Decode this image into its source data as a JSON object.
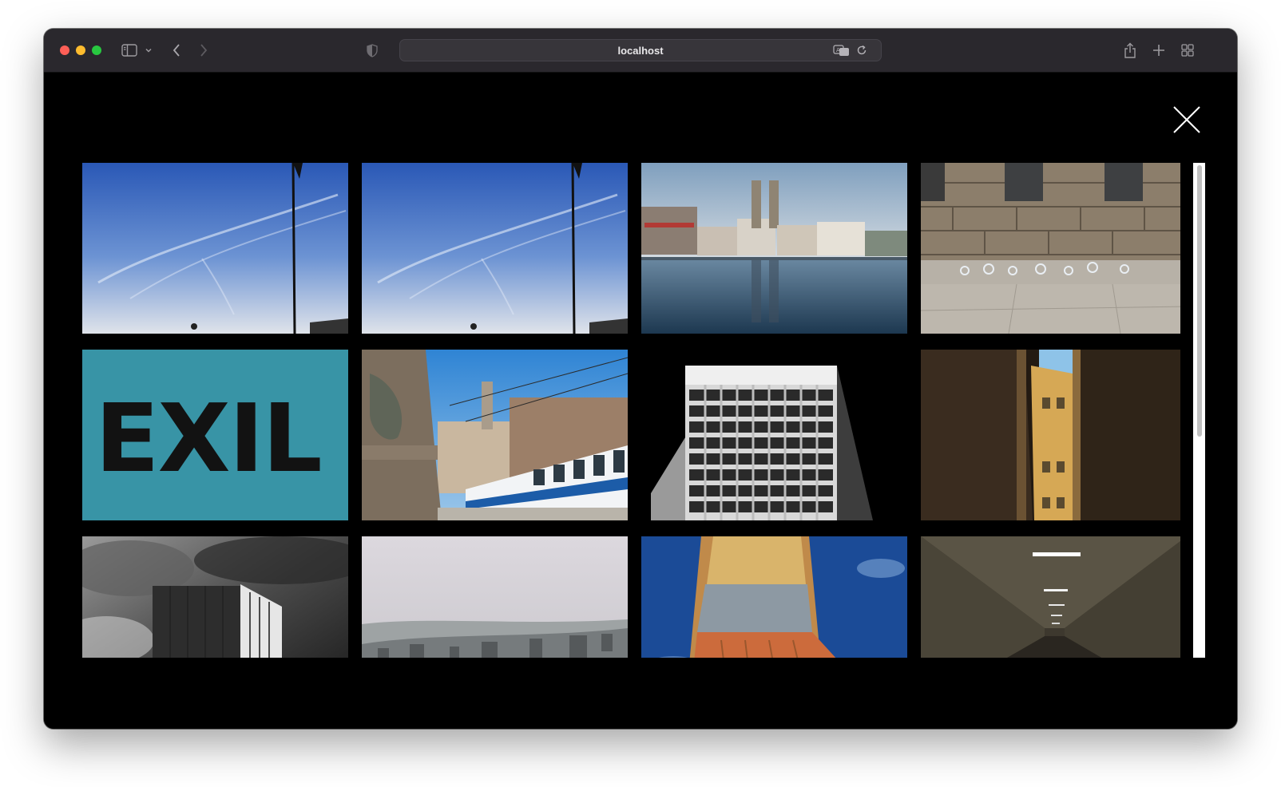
{
  "browser": {
    "url": "localhost",
    "icons": {
      "sidebar": "sidebar-icon",
      "back": "chevron-left-icon",
      "forward": "chevron-right-icon",
      "shield": "shield-icon",
      "translate": "translate-icon",
      "reload": "reload-icon",
      "share": "share-icon",
      "new_tab": "plus-icon",
      "tab_overview": "grid-icon"
    }
  },
  "overlay": {
    "close_icon": "close-icon"
  },
  "gallery": {
    "columns": 4,
    "visible_rows": 3,
    "photos": [
      {
        "id": 1,
        "subject": "sky-with-flagpole",
        "colors": [
          "#2f5fb8",
          "#c9d7ea"
        ]
      },
      {
        "id": 2,
        "subject": "sky-with-flagpole",
        "colors": [
          "#2f5fb8",
          "#c9d7ea"
        ]
      },
      {
        "id": 3,
        "subject": "river-city-churches",
        "colors": [
          "#a9c0d6",
          "#27435a"
        ]
      },
      {
        "id": 4,
        "subject": "stone-wall-graffiti",
        "colors": [
          "#9a8c78",
          "#b9b2a6"
        ]
      },
      {
        "id": 5,
        "subject": "exil-sign",
        "colors": [
          "#3a9fb0",
          "#111111"
        ]
      },
      {
        "id": 6,
        "subject": "tram-and-statue",
        "colors": [
          "#3c8fd8",
          "#ffffff"
        ]
      },
      {
        "id": 7,
        "subject": "bw-office-building",
        "colors": [
          "#000000",
          "#bdbdbd"
        ]
      },
      {
        "id": 8,
        "subject": "narrow-alley",
        "colors": [
          "#2c2116",
          "#d9a94a"
        ]
      },
      {
        "id": 9,
        "subject": "bw-tower-clouds",
        "colors": [
          "#6e6e6e",
          "#1c1c1c"
        ]
      },
      {
        "id": 10,
        "subject": "hazy-city-view",
        "colors": [
          "#d8d6dc",
          "#5f6364"
        ]
      },
      {
        "id": 11,
        "subject": "container-tower",
        "colors": [
          "#1b4f9c",
          "#c86a3a"
        ]
      },
      {
        "id": 12,
        "subject": "dark-tunnel",
        "colors": [
          "#4d473b",
          "#1c1a16"
        ]
      }
    ]
  }
}
